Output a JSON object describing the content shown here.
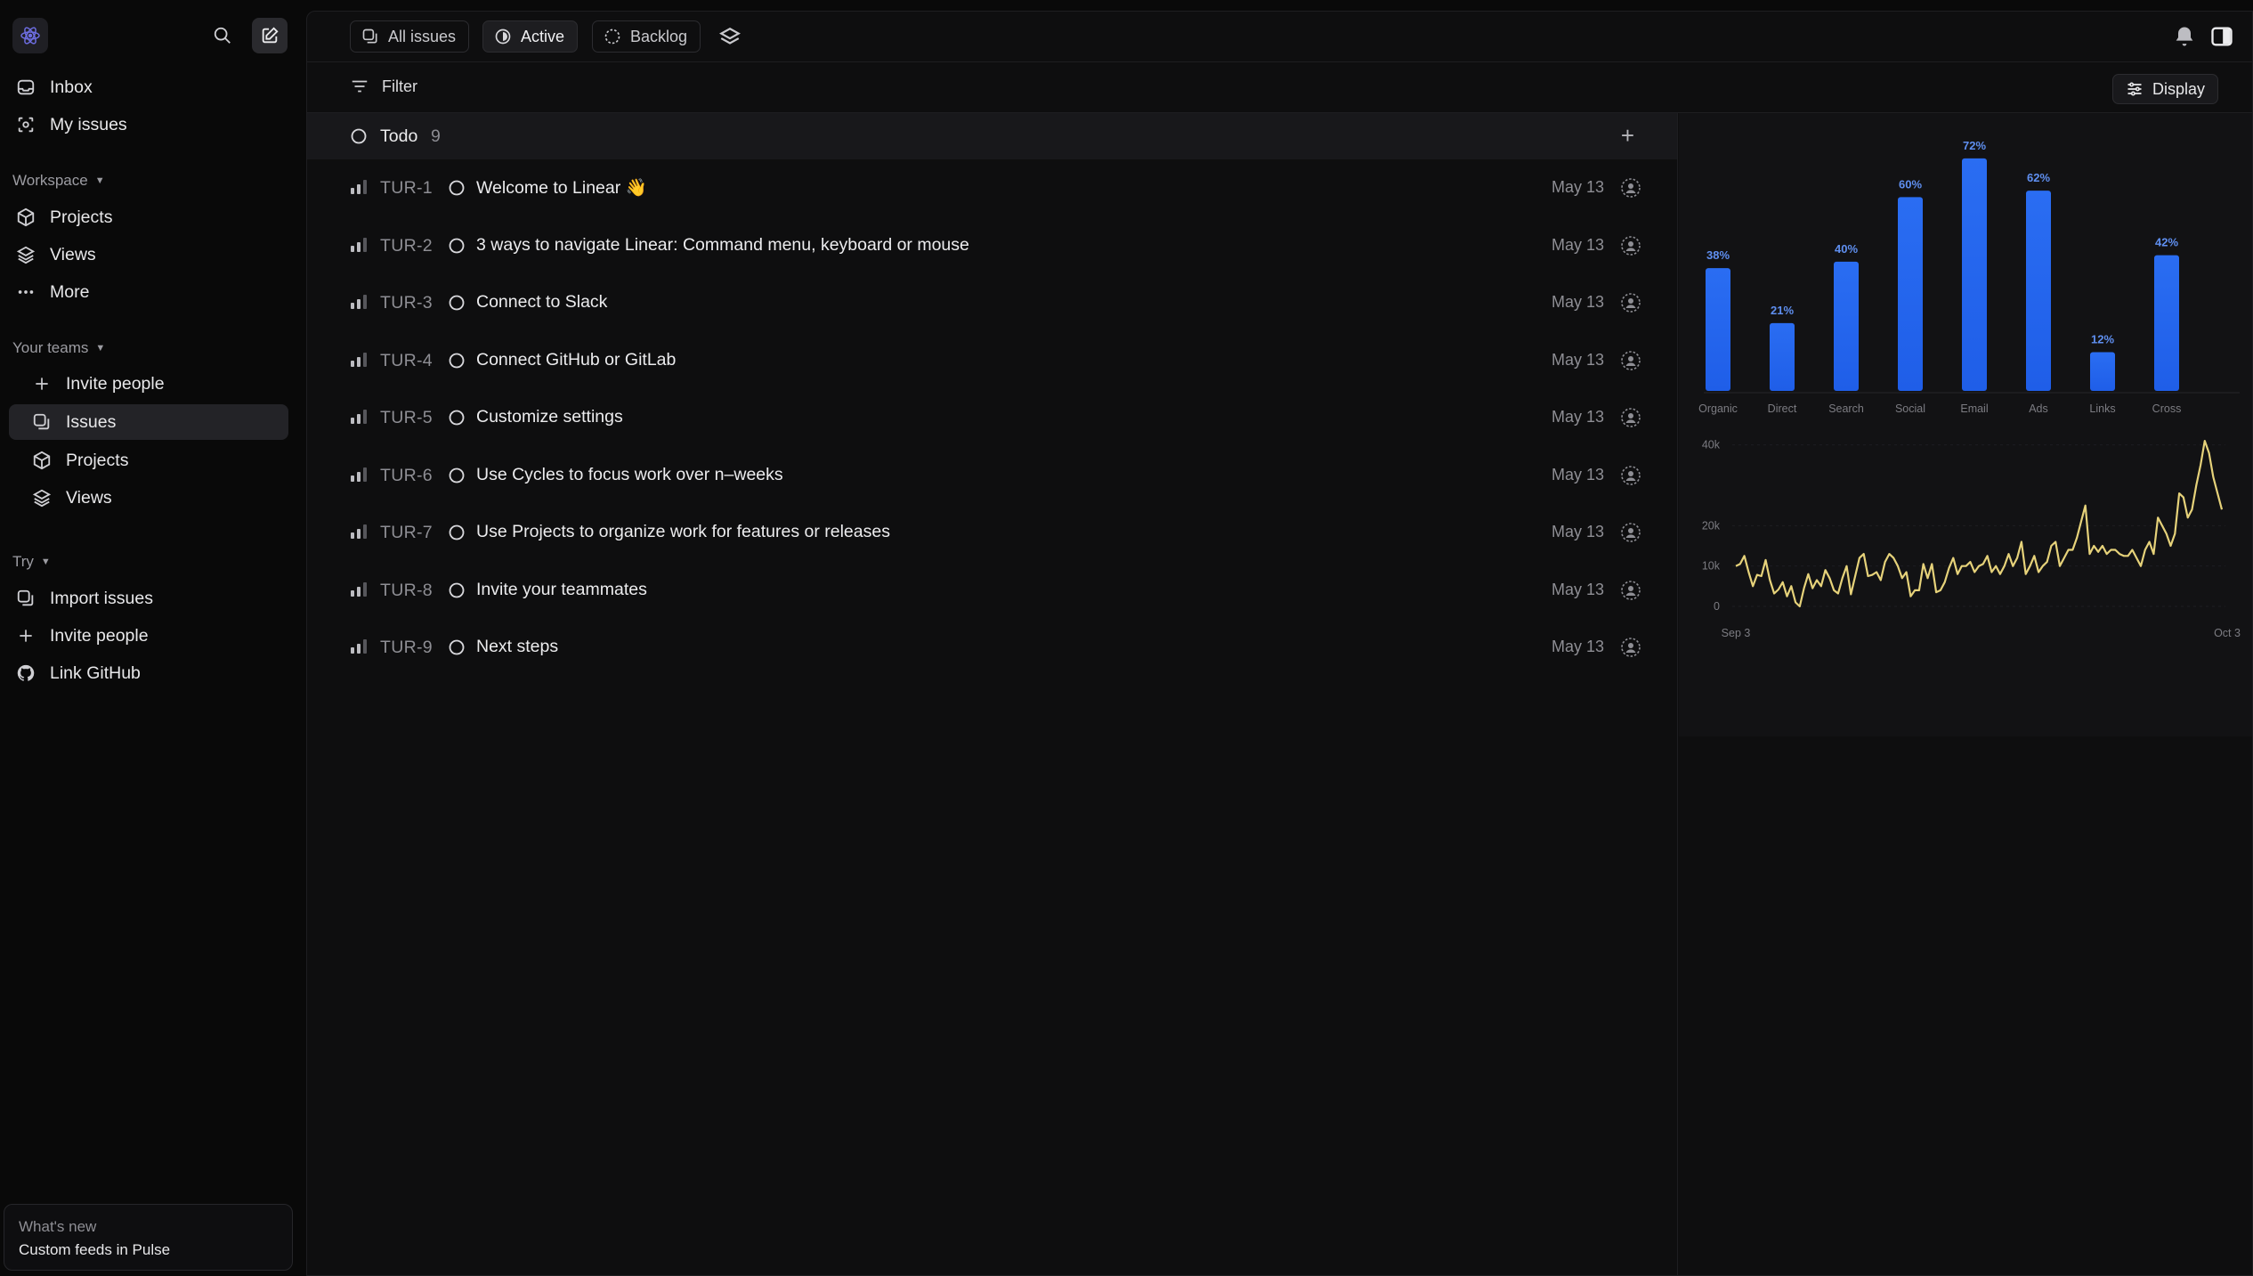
{
  "sidebar": {
    "top_items": [
      {
        "label": "Inbox",
        "icon": "inbox-icon"
      },
      {
        "label": "My issues",
        "icon": "my-issues-icon"
      }
    ],
    "workspace_label": "Workspace",
    "workspace_items": [
      {
        "label": "Projects",
        "icon": "cube-icon"
      },
      {
        "label": "Views",
        "icon": "layers-icon"
      },
      {
        "label": "More",
        "icon": "more-dots-icon"
      }
    ],
    "teams_label": "Your teams",
    "team_items": [
      {
        "label": "Invite people",
        "icon": "plus-icon"
      },
      {
        "label": "Issues",
        "icon": "issues-icon",
        "active": true
      },
      {
        "label": "Projects",
        "icon": "cube-icon"
      },
      {
        "label": "Views",
        "icon": "layers-icon"
      }
    ],
    "try_label": "Try",
    "try_items": [
      {
        "label": "Import issues",
        "icon": "import-icon"
      },
      {
        "label": "Invite people",
        "icon": "plus-icon"
      },
      {
        "label": "Link GitHub",
        "icon": "github-icon"
      }
    ],
    "whats_new": {
      "title": "What's new",
      "subtitle": "Custom feeds in Pulse"
    }
  },
  "tabs": [
    {
      "label": "All issues",
      "icon": "all-issues-icon"
    },
    {
      "label": "Active",
      "icon": "active-half-circle-icon",
      "active": true
    },
    {
      "label": "Backlog",
      "icon": "backlog-dashed-circle-icon"
    }
  ],
  "toolbar": {
    "filter_label": "Filter",
    "display_label": "Display"
  },
  "group": {
    "name": "Todo",
    "count": "9"
  },
  "issues": [
    {
      "key": "TUR-1",
      "title": "Welcome to Linear 👋",
      "date": "May 13"
    },
    {
      "key": "TUR-2",
      "title": "3 ways to navigate Linear: Command menu, keyboard or mouse",
      "date": "May 13"
    },
    {
      "key": "TUR-3",
      "title": "Connect to Slack",
      "date": "May 13"
    },
    {
      "key": "TUR-4",
      "title": "Connect GitHub or GitLab",
      "date": "May 13"
    },
    {
      "key": "TUR-5",
      "title": "Customize settings",
      "date": "May 13"
    },
    {
      "key": "TUR-6",
      "title": "Use Cycles to focus work over n–weeks",
      "date": "May 13"
    },
    {
      "key": "TUR-7",
      "title": "Use Projects to organize work for features or releases",
      "date": "May 13"
    },
    {
      "key": "TUR-8",
      "title": "Invite your teammates",
      "date": "May 13"
    },
    {
      "key": "TUR-9",
      "title": "Next steps",
      "date": "May 13"
    }
  ],
  "colors": {
    "bar": "#1f5ee8",
    "line": "#e6d27a",
    "accent": "#5b5bd6"
  },
  "chart_data": [
    {
      "type": "bar",
      "categories": [
        "Organic",
        "Direct",
        "Search",
        "Social",
        "Email",
        "Ads",
        "Links",
        "Cross"
      ],
      "values": [
        38,
        21,
        40,
        60,
        72,
        62,
        12,
        42
      ],
      "value_labels": [
        "38%",
        "21%",
        "40%",
        "60%",
        "72%",
        "62%",
        "12%",
        "42%"
      ],
      "ylim": [
        0,
        75
      ]
    },
    {
      "type": "line",
      "x_labels": [
        "Sep 3",
        "Oct 3"
      ],
      "y_ticks": [
        0,
        10000,
        20000,
        40000
      ],
      "y_tick_labels": [
        "0",
        "10k",
        "20k",
        "40k"
      ],
      "ylim": [
        0,
        45000
      ],
      "values": [
        10000,
        10500,
        12500,
        8500,
        5000,
        7800,
        7500,
        11500,
        6500,
        3200,
        4200,
        6000,
        2500,
        5000,
        1000,
        0,
        4500,
        8000,
        4500,
        6500,
        5000,
        9000,
        7000,
        4000,
        3200,
        7000,
        10000,
        3000,
        7500,
        12000,
        13000,
        7500,
        7800,
        8500,
        6500,
        11000,
        13000,
        12000,
        10000,
        7000,
        8500,
        2500,
        4000,
        4000,
        10500,
        7000,
        10500,
        3500,
        4000,
        6000,
        9500,
        12000,
        8000,
        10000,
        10000,
        11000,
        8500,
        10000,
        10500,
        12500,
        8500,
        10000,
        8000,
        10000,
        13000,
        10000,
        12000,
        16000,
        8000,
        10000,
        12500,
        8500,
        10000,
        11000,
        15000,
        16000,
        10000,
        12000,
        14000,
        14000,
        17000,
        21000,
        25000,
        13000,
        15000,
        13500,
        15000,
        13000,
        14000,
        14000,
        13000,
        12500,
        12500,
        14000,
        12000,
        10000,
        14000,
        16000,
        13000,
        22000,
        20000,
        18000,
        15000,
        18000,
        28000,
        27000,
        22000,
        24000,
        30000,
        35000,
        41000,
        38000,
        32000,
        28000,
        24000
      ]
    }
  ]
}
